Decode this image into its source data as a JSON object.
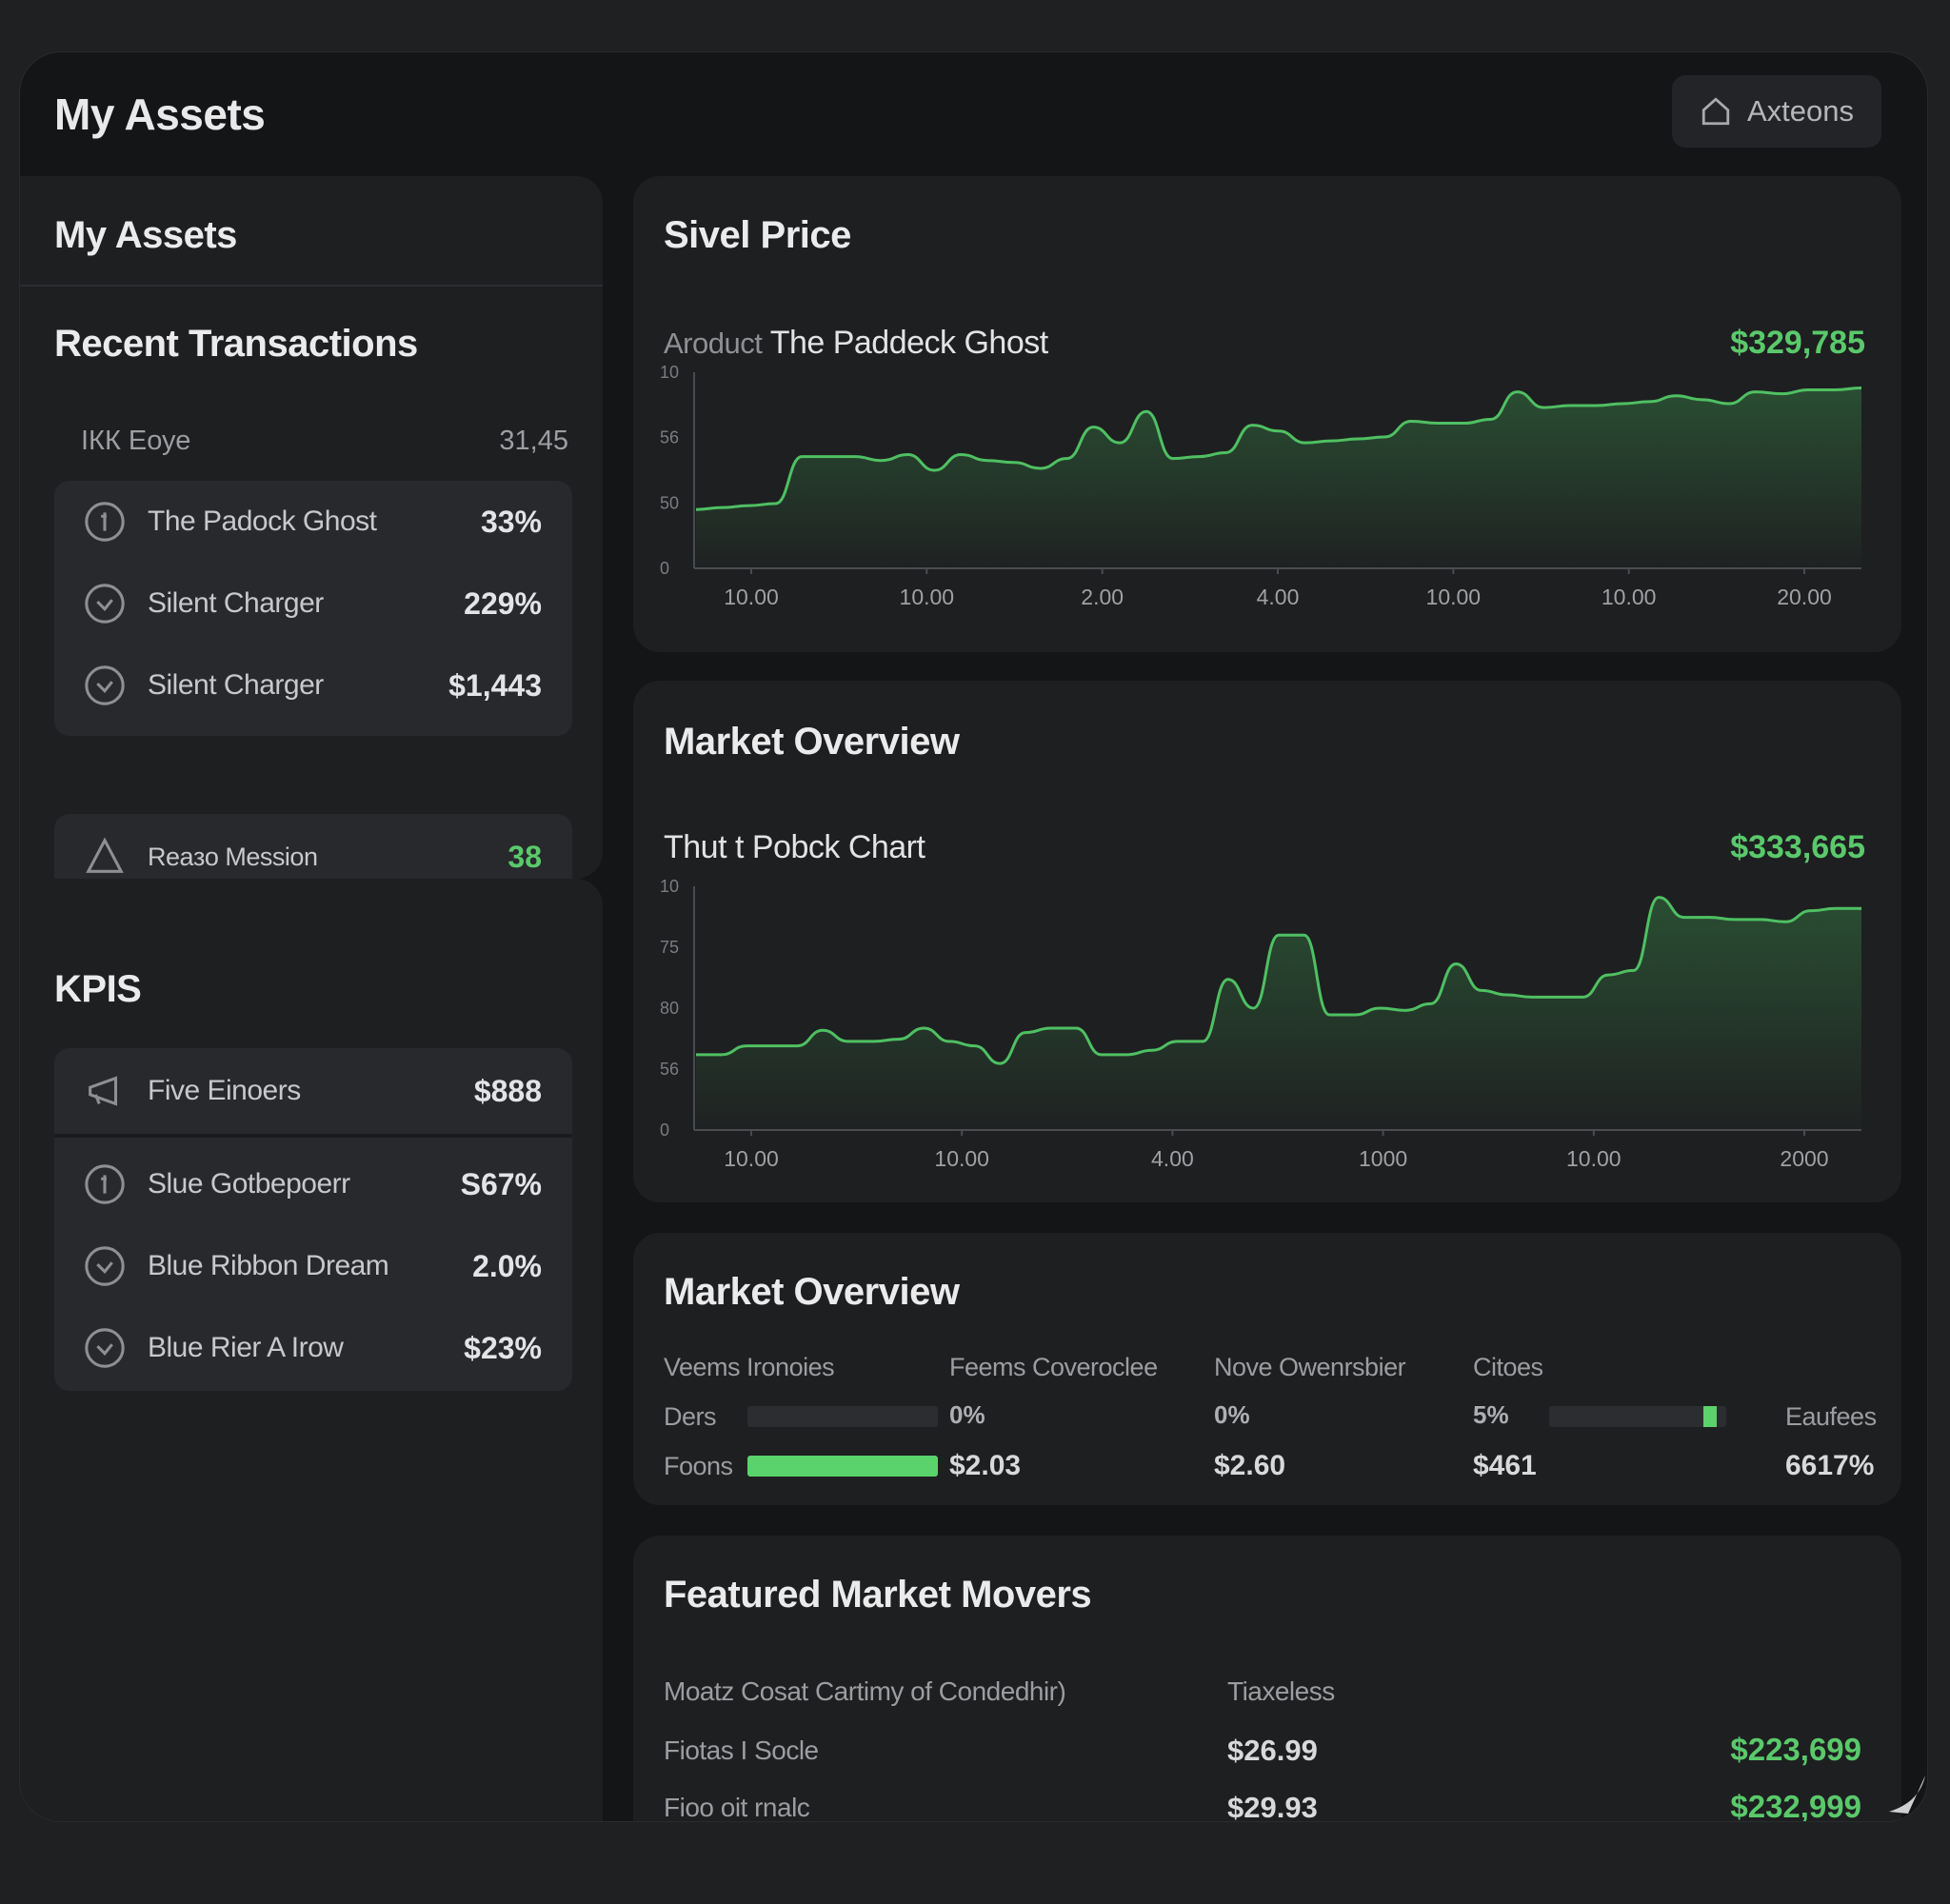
{
  "header": {
    "title": "My Assets",
    "button_label": "Axteons",
    "button_icon": "home-icon"
  },
  "assets_panel": {
    "title": "My Assets",
    "recent_title": "Recent Transactions",
    "summary_row": {
      "label": "ІКК Еоуе",
      "value": "31,45"
    },
    "items": [
      {
        "icon": "coin-icon",
        "label": "The Padock Ghost",
        "value": "33%"
      },
      {
        "icon": "check-circle-icon",
        "label": "Silent Charger",
        "value": "229%"
      },
      {
        "icon": "check-circle-icon",
        "label": "Silent Charger",
        "value": "$1,443"
      }
    ],
    "extra_row": {
      "icon": "triangle-icon",
      "label": "Reaзo Мession",
      "value": "38"
    }
  },
  "kpis_panel": {
    "title": "KPIS",
    "top_row": {
      "icon": "megaphone-icon",
      "label": "Five Einoers",
      "value": "$888"
    },
    "items": [
      {
        "icon": "coin-icon",
        "label": "Slue Gotbepoerr",
        "value": "S67%"
      },
      {
        "icon": "check-circle-icon",
        "label": "Blue Ribbon Dream",
        "value": "2.0%"
      },
      {
        "icon": "check-circle-icon",
        "label": "Blue Riеr A Irow",
        "value": "$23%"
      }
    ]
  },
  "price_card": {
    "title": "Sivel Price",
    "sub_prefix": "Aroduct",
    "sub_title": "The Paddeck Ghost",
    "value": "$329,785",
    "accent": "#5ac96b",
    "chart_data": {
      "type": "area",
      "y_ticks": [
        "10",
        "56",
        "50",
        "0"
      ],
      "x_ticks": [
        "10.00",
        "10.00",
        "2.00",
        "4.00",
        "10.00",
        "10.00",
        "20.00"
      ],
      "values": [
        30,
        31,
        32,
        33,
        57,
        57,
        57,
        55,
        58,
        50,
        58,
        55,
        54,
        51,
        56,
        72,
        64,
        80,
        56,
        57,
        59,
        73,
        70,
        64,
        65,
        66,
        67,
        75,
        74,
        74,
        76,
        90,
        82,
        83,
        83,
        84,
        85,
        88,
        86,
        84,
        90,
        89,
        91,
        91,
        92
      ]
    }
  },
  "overview_chart_card": {
    "title": "Market Overview",
    "sub_title": "Thut t Pobck Chart",
    "value": "$333,665",
    "chart_data": {
      "type": "area",
      "y_ticks": [
        "10",
        "75",
        "80",
        "56",
        "0"
      ],
      "x_ticks": [
        "10.00",
        "10.00",
        "4.00",
        "1000",
        "10.00",
        "2000"
      ],
      "values": [
        34,
        34,
        38,
        38,
        38,
        45,
        40,
        40,
        41,
        46,
        40,
        38,
        30,
        44,
        46,
        46,
        34,
        34,
        36,
        40,
        40,
        68,
        55,
        88,
        88,
        52,
        52,
        55,
        54,
        57,
        75,
        63,
        61,
        60,
        60,
        60,
        70,
        72,
        105,
        96,
        96,
        95,
        95,
        94,
        99,
        100,
        100
      ]
    }
  },
  "market_overview": {
    "title": "Market Overview",
    "col_headers": [
      "Veems Ironoies",
      "Feems Coveroclee",
      "Nove Owenrsbier",
      "Citoes"
    ],
    "row1": {
      "label": "Ders",
      "bar_fill": 0,
      "c2": "0%",
      "c3": "0%",
      "c4": "5%",
      "bar2_fill": 0.95,
      "c5": "Eaufees"
    },
    "row2": {
      "label": "Foons",
      "bar_fill": 1.0,
      "c2": "$2.03",
      "c3": "$2.60",
      "c4": "$461",
      "c5": "6617%"
    }
  },
  "movers": {
    "title": "Featured Market Movers",
    "col1_header": "Moatz Cosat Cartimy of Condedhir)",
    "col2_header": "Tiaxeless",
    "rows": [
      {
        "name": "Fiotas I Socle",
        "price": "$26.99",
        "change": "$223,699"
      },
      {
        "name": "Fioo oit rnalc",
        "price": "$29.93",
        "change": "$232,999"
      }
    ]
  }
}
